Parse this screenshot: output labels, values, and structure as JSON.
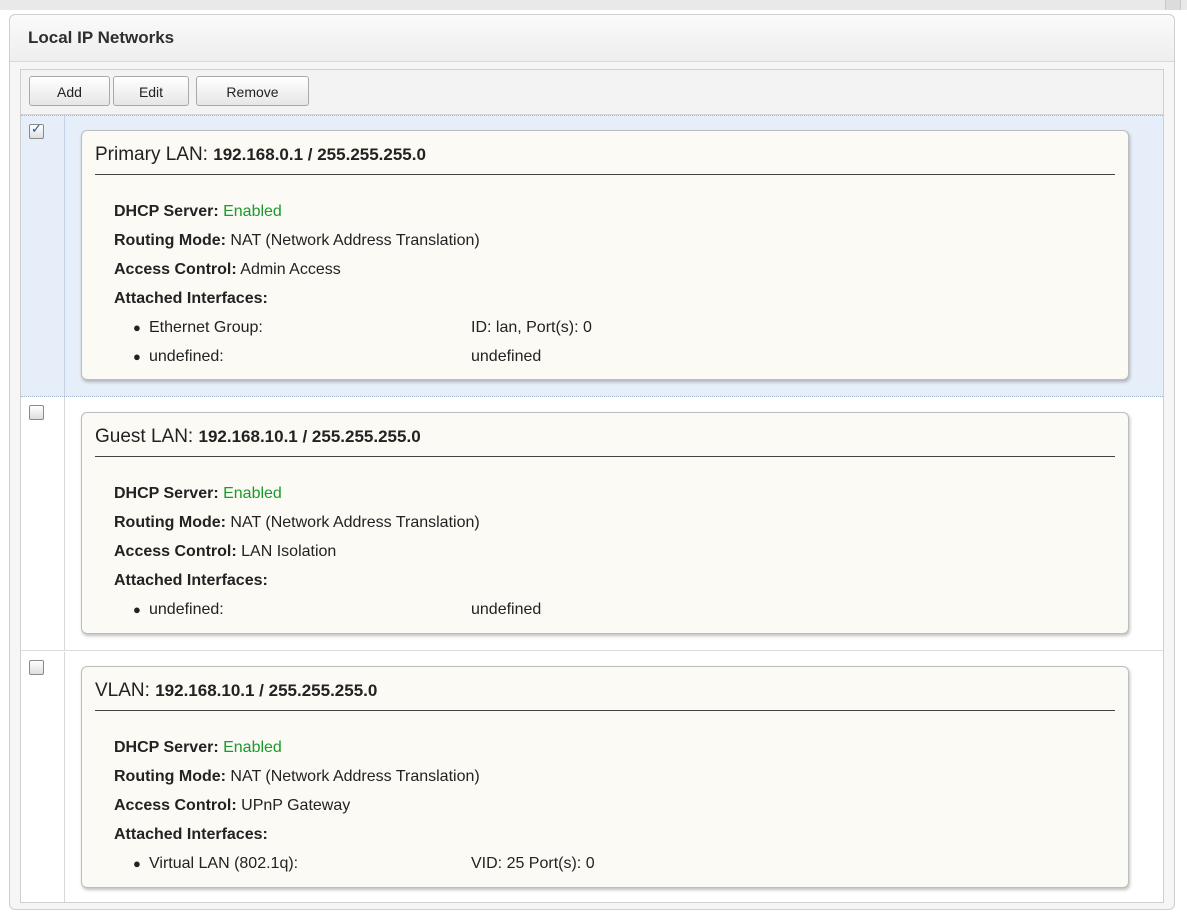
{
  "panel": {
    "title": "Local IP Networks"
  },
  "toolbar": {
    "add_label": "Add",
    "edit_label": "Edit",
    "remove_label": "Remove"
  },
  "labels": {
    "dhcp": "DHCP Server:",
    "routing": "Routing Mode:",
    "access": "Access Control:",
    "interfaces": "Attached Interfaces:"
  },
  "networks": [
    {
      "checked": true,
      "name": "Primary LAN:",
      "address": "192.168.0.1 / 255.255.255.0",
      "dhcp": "Enabled",
      "routing": "NAT (Network Address Translation)",
      "access": "Admin Access",
      "interfaces": [
        {
          "name": "Ethernet Group:",
          "info": "ID: lan, Port(s): 0"
        },
        {
          "name": "undefined:",
          "info": "undefined"
        }
      ]
    },
    {
      "checked": false,
      "name": "Guest LAN:",
      "address": "192.168.10.1 / 255.255.255.0",
      "dhcp": "Enabled",
      "routing": "NAT (Network Address Translation)",
      "access": "LAN Isolation",
      "interfaces": [
        {
          "name": "undefined:",
          "info": "undefined"
        }
      ]
    },
    {
      "checked": false,
      "name": "VLAN:",
      "address": "192.168.10.1 / 255.255.255.0",
      "dhcp": "Enabled",
      "routing": "NAT (Network Address Translation)",
      "access": "UPnP Gateway",
      "interfaces": [
        {
          "name": "Virtual LAN (802.1q):",
          "info": "VID: 25 Port(s): 0"
        }
      ]
    }
  ],
  "colors": {
    "enabled": "#1a9a2a",
    "selected_row": "#e6eef9",
    "card_bg": "#fbfaf5"
  }
}
